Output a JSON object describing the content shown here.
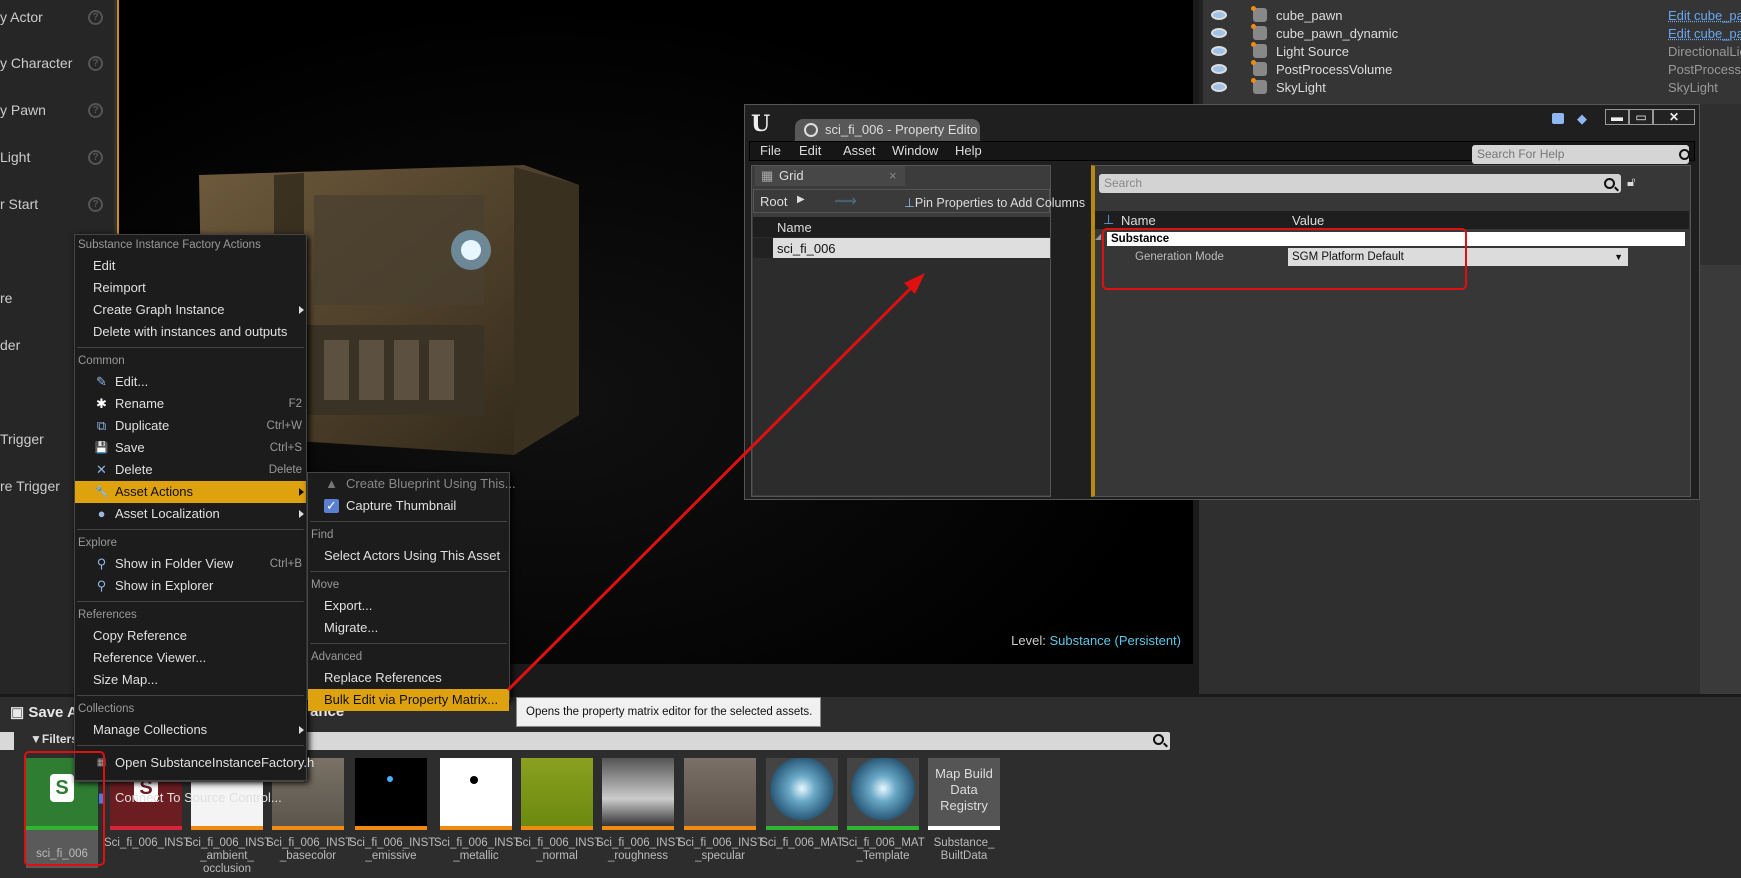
{
  "left_panel": {
    "items": [
      "y Actor",
      "y Character",
      "y Pawn",
      "Light",
      "r Start",
      "re",
      "der",
      "Trigger",
      "re Trigger"
    ],
    "help_glyph": "?"
  },
  "viewport": {
    "level_label": "Level:",
    "level_value": "Substance (Persistent)"
  },
  "outliner": {
    "rows": [
      {
        "name": "cube_pawn",
        "type": "Edit cube_paw",
        "link": true
      },
      {
        "name": "cube_pawn_dynamic",
        "type": "Edit cube_paw",
        "link": true
      },
      {
        "name": "Light Source",
        "type": "DirectionalLigh",
        "link": false
      },
      {
        "name": "PostProcessVolume",
        "type": "PostProcessVo",
        "link": false
      },
      {
        "name": "SkyLight",
        "type": "SkyLight",
        "link": false
      }
    ]
  },
  "content_browser": {
    "save_label": "Save A",
    "path_label": "ance",
    "filters_label": "Filters",
    "assets": [
      {
        "label": "sci_fi_006",
        "kind": "factory",
        "bar": "#2fb52f"
      },
      {
        "label": "Sci_fi_006_INST",
        "kind": "instance",
        "bar": "#d8243a"
      },
      {
        "label": "Sci_fi_006_INST _ambient_ occlusion",
        "kind": "ao",
        "bar": "#f08a10"
      },
      {
        "label": "Sci_fi_006_INST _basecolor",
        "kind": "basecolor",
        "bar": "#f08a10"
      },
      {
        "label": "Sci_fi_006_INST _emissive",
        "kind": "emissive",
        "bar": "#f08a10"
      },
      {
        "label": "Sci_fi_006_INST _metallic",
        "kind": "metallic",
        "bar": "#f08a10"
      },
      {
        "label": "Sci_fi_006_INST _normal",
        "kind": "normal",
        "bar": "#f08a10"
      },
      {
        "label": "Sci_fi_006_INST _roughness",
        "kind": "roughness",
        "bar": "#f08a10"
      },
      {
        "label": "Sci_fi_006_INST _specular",
        "kind": "specular",
        "bar": "#f08a10"
      },
      {
        "label": "Sci_fi_006_MAT",
        "kind": "material",
        "bar": "#2fb52f"
      },
      {
        "label": "Sci_fi_006_MAT _Template",
        "kind": "material",
        "bar": "#2fb52f"
      },
      {
        "label": "Substance_ BuiltData",
        "kind": "mapbuild",
        "bar": "#ffffff",
        "thumb_text": "Map Build Data Registry"
      }
    ]
  },
  "context_menu": {
    "section_factory": "Substance Instance Factory Actions",
    "factory_items": [
      "Edit",
      "Reimport",
      "Create Graph Instance",
      "Delete with instances and outputs"
    ],
    "section_common": "Common",
    "common_items": [
      {
        "label": "Edit...",
        "icon": "✎",
        "shortcut": ""
      },
      {
        "label": "Rename",
        "icon": "✱",
        "shortcut": "F2"
      },
      {
        "label": "Duplicate",
        "icon": "⧉",
        "shortcut": "Ctrl+W"
      },
      {
        "label": "Save",
        "icon": "💾",
        "shortcut": "Ctrl+S"
      },
      {
        "label": "Delete",
        "icon": "✕",
        "shortcut": "Delete"
      },
      {
        "label": "Asset Actions",
        "icon": "🔧",
        "shortcut": ""
      },
      {
        "label": "Asset Localization",
        "icon": "●",
        "shortcut": ""
      }
    ],
    "section_explore": "Explore",
    "explore_items": [
      {
        "label": "Show in Folder View",
        "shortcut": "Ctrl+B"
      },
      {
        "label": "Show in Explorer",
        "shortcut": ""
      }
    ],
    "section_references": "References",
    "reference_items": [
      "Copy Reference",
      "Reference Viewer...",
      "Size Map..."
    ],
    "section_collections": "Collections",
    "collection_items": [
      "Manage Collections"
    ],
    "open_source": "Open SubstanceInstanceFactory.h",
    "source_control": "Connect To Source Control..."
  },
  "submenu": {
    "items": [
      "Create Blueprint Using This...",
      "Capture Thumbnail"
    ],
    "section_find": "Find",
    "find_item": "Select Actors Using This Asset",
    "section_move": "Move",
    "move_items": [
      "Export...",
      "Migrate..."
    ],
    "section_advanced": "Advanced",
    "advanced_items": [
      "Replace References",
      "Bulk Edit via Property Matrix..."
    ]
  },
  "tooltip": "Opens the property matrix editor for the selected assets.",
  "property_editor": {
    "tab_title": "sci_fi_006 - Property Edito",
    "menu": [
      "File",
      "Edit",
      "Asset",
      "Window",
      "Help"
    ],
    "help_search_placeholder": "Search For Help",
    "grid_tab": "Grid",
    "root": "Root",
    "pin_hint": "Pin Properties to Add Columns",
    "grid_col": "Name",
    "grid_row": "sci_fi_006",
    "details_search_placeholder": "Search",
    "col_name": "Name",
    "col_value": "Value",
    "category": "Substance",
    "property": "Generation Mode",
    "property_value": "SGM Platform Default"
  },
  "colors": {
    "accent": "#dea20e",
    "annotation": "#e01010",
    "link": "#5fc7e8"
  }
}
